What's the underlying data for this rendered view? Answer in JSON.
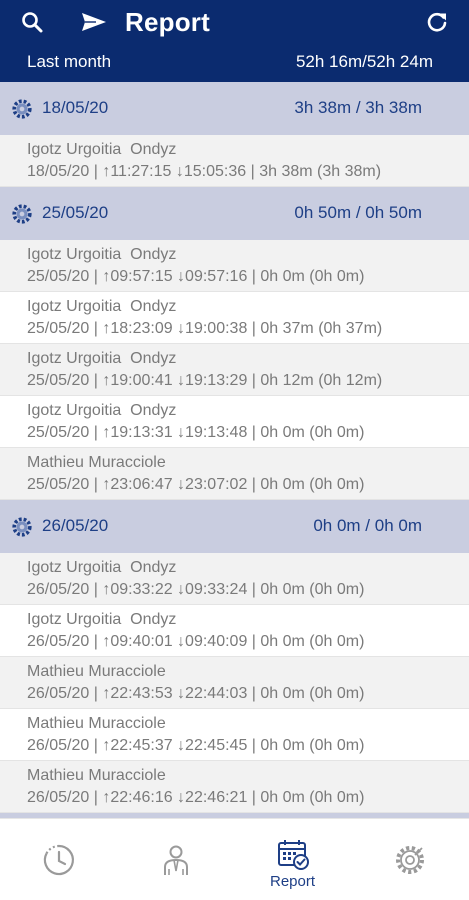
{
  "header": {
    "title": "Report",
    "period": "Last month",
    "total": "52h 16m/52h 24m",
    "icons": [
      "search-icon",
      "send-icon",
      "refresh-icon"
    ]
  },
  "days": [
    {
      "date": "18/05/20",
      "duration": "3h 38m / 3h 38m",
      "entries": [
        {
          "name": "Igotz Urgoitia  Ondyz",
          "detail": "18/05/20 | ↑11:27:15 ↓15:05:36 | 3h 38m (3h 38m)"
        }
      ]
    },
    {
      "date": "25/05/20",
      "duration": "0h 50m / 0h 50m",
      "entries": [
        {
          "name": "Igotz Urgoitia  Ondyz",
          "detail": "25/05/20 | ↑09:57:15 ↓09:57:16 | 0h 0m (0h 0m)"
        },
        {
          "name": "Igotz Urgoitia  Ondyz",
          "detail": "25/05/20 | ↑18:23:09 ↓19:00:38 | 0h 37m (0h 37m)"
        },
        {
          "name": "Igotz Urgoitia  Ondyz",
          "detail": "25/05/20 | ↑19:00:41 ↓19:13:29 | 0h 12m (0h 12m)"
        },
        {
          "name": "Igotz Urgoitia  Ondyz",
          "detail": "25/05/20 | ↑19:13:31 ↓19:13:48 | 0h 0m (0h 0m)"
        },
        {
          "name": "Mathieu Muracciole",
          "detail": "25/05/20 | ↑23:06:47 ↓23:07:02 | 0h 0m (0h 0m)"
        }
      ]
    },
    {
      "date": "26/05/20",
      "duration": "0h 0m / 0h 0m",
      "entries": [
        {
          "name": "Igotz Urgoitia  Ondyz",
          "detail": "26/05/20 | ↑09:33:22 ↓09:33:24 | 0h 0m (0h 0m)"
        },
        {
          "name": "Igotz Urgoitia  Ondyz",
          "detail": "26/05/20 | ↑09:40:01 ↓09:40:09 | 0h 0m (0h 0m)"
        },
        {
          "name": "Mathieu Muracciole",
          "detail": "26/05/20 | ↑22:43:53 ↓22:44:03 | 0h 0m (0h 0m)"
        },
        {
          "name": "Mathieu Muracciole",
          "detail": "26/05/20 | ↑22:45:37 ↓22:45:45 | 0h 0m (0h 0m)"
        },
        {
          "name": "Mathieu Muracciole",
          "detail": "26/05/20 | ↑22:46:16 ↓22:46:21 | 0h 0m (0h 0m)"
        }
      ]
    }
  ],
  "bottom_nav": {
    "items": [
      {
        "icon": "history-clock-icon",
        "label": ""
      },
      {
        "icon": "employee-icon",
        "label": ""
      },
      {
        "icon": "calendar-check-icon",
        "label": "Report",
        "active": true
      },
      {
        "icon": "settings-gear-icon",
        "label": ""
      }
    ]
  },
  "colors": {
    "header_bg": "#0b2b6f",
    "day_header_bg": "#c9cde0",
    "accent_text": "#1e3f86",
    "entry_text": "#7a7a7a",
    "alt_row_bg": "#f2f2f2"
  }
}
